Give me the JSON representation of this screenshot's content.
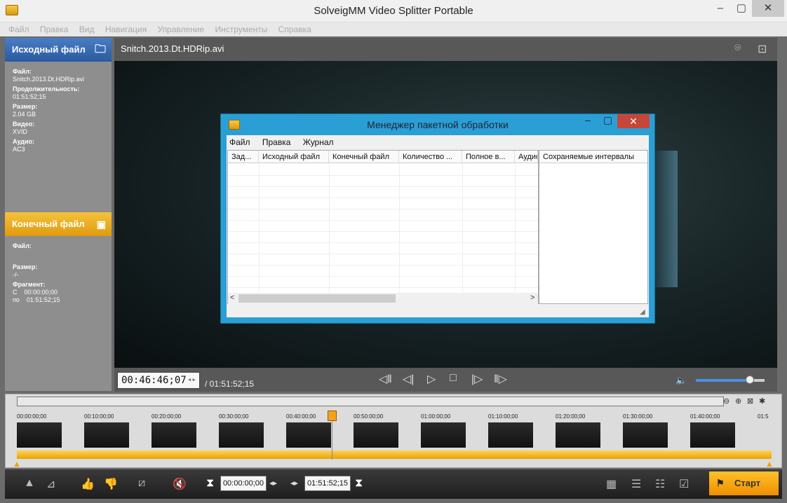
{
  "window": {
    "title": "SolveigMM Video Splitter Portable",
    "minimize": "‒",
    "maximize": "▢",
    "close": "✕"
  },
  "menu": [
    "Файл",
    "Правка",
    "Вид",
    "Навигация",
    "Управление",
    "Инструменты",
    "Справка"
  ],
  "source": {
    "header": "Исходный файл",
    "file_label": "Файл:",
    "file": "Snitch.2013.Dt.HDRip.avi",
    "duration_label": "Продолжительность:",
    "duration": "01:51:52;15",
    "size_label": "Размер:",
    "size": "2.04 GB",
    "video_label": "Видео:",
    "video": "XVID",
    "audio_label": "Аудио:",
    "audio": "AC3"
  },
  "dest": {
    "header": "Конечный файл",
    "file_label": "Файл:",
    "size_label": "Размер:",
    "size": "-/-",
    "fragment_label": "Фрагмент:",
    "from_label": "С",
    "from": "00:00:00;00",
    "to_label": "по",
    "to": "01:51:52;15"
  },
  "player": {
    "filename": "Snitch.2013.Dt.HDRip.avi",
    "timecode": "00:46:46;07",
    "duration": "/ 01:51:52;15",
    "volume_pct": 79
  },
  "timeline": {
    "ticks": [
      "00:00:00;00",
      "00:10:00;00",
      "00:20:00;00",
      "00:30:00;00",
      "00:40:00;00",
      "00:50:00;00",
      "01:00:00;00",
      "01:10:00;00",
      "01:20:00;00",
      "01:30:00;00",
      "01:40:00;00",
      "01:5"
    ]
  },
  "bottom": {
    "start_tc": "00:00:00;00",
    "end_tc": "01:51:52;15",
    "start_label": "Старт"
  },
  "dialog": {
    "title": "Менеджер пакетной обработки",
    "menu": [
      "Файл",
      "Правка",
      "Журнал"
    ],
    "columns": [
      "Зад...",
      "Исходный файл",
      "Конечный файл",
      "Количество ...",
      "Полное в...",
      "Аудио"
    ],
    "intervals_header": "Сохраняемые интервалы",
    "minimize": "‒",
    "maximize": "▢",
    "close": "✕"
  },
  "colors": {
    "accent_blue": "#2a5aa0",
    "accent_orange": "#f5a623",
    "dialog_frame": "#2a9fd6"
  }
}
